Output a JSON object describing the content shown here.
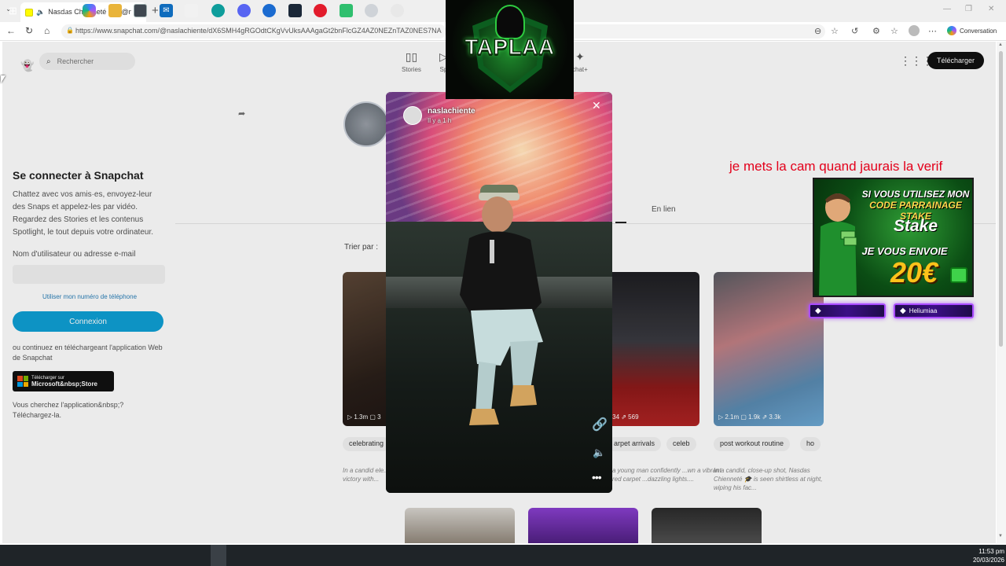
{
  "browser": {
    "tab_title": "Nasdas Chienneté 🎓 (@nasl",
    "tab_close": "✕",
    "new_tab": "+",
    "url": "https://www.snapchat.com/@naslachiente/dX6SMH4gRGOdtCKgVvUksAAAgaGt2bnFlcGZ4AZ0NEZnTAZ0NES7NA",
    "copilot_label": "Conversation",
    "window_controls": [
      "—",
      "❐",
      "✕"
    ]
  },
  "header": {
    "search_placeholder": "Rechercher",
    "nav": [
      {
        "label": "Stories",
        "icon": "stories-icon"
      },
      {
        "label": "Sp",
        "icon": "spotlight-icon"
      },
      {
        "label": "chat+",
        "icon": "snapchat-plus-icon"
      }
    ],
    "download_label": "Télécharger"
  },
  "login": {
    "title": "Se connecter à Snapchat",
    "description": "Chattez avec vos amis·es, envoyez-leur des Snaps et appelez-les par vidéo. Regardez des Stories et les contenus Spotlight, le tout depuis votre ordinateur.",
    "field_label": "Nom d'utilisateur ou adresse e-mail",
    "phone_link": "Utiliser mon numéro de téléphone",
    "login_button": "Connexion",
    "alt_text": "ou continuez en téléchargeant l'application Web de Snapchat",
    "store_small": "Télécharger sur",
    "store_name": "Microsoft&nbsp;Store",
    "looking_text": "Vous cherchez l'application&nbsp;? Téléchargez-la."
  },
  "profile": {
    "tab_label": "En lien",
    "sort_label": "Trier par :"
  },
  "cards": [
    {
      "stats": "▷ 1.3m  ▢ 3",
      "chip": "celebrating",
      "caption": "In a candid ele... Nasdas Chien... a victory with..."
    },
    {
      "stats": "m  ▢ 634  ⇗ 569",
      "chip": "arpet arrivals",
      "chip2": "celeb",
      "caption": "a young man confidently ...wn a vibrant red carpet ...dazzling lights...."
    },
    {
      "stats": "▷ 2.1m  ▢ 1.9k  ⇗ 3.3k",
      "chip": "post workout routine",
      "chip2": "ho",
      "caption": "In a candid, close-up shot, Nasdas Chienneté 🎓 is seen shirtless at night, wiping his fac..."
    }
  ],
  "story": {
    "username": "naslachiente",
    "time": "Il y a 1 h",
    "close": "✕",
    "link_icon": "link-icon",
    "sound_icon": "speaker-icon",
    "more": "•••"
  },
  "stream": {
    "logo_text": "TAPLAA",
    "cam_message": "je mets la cam quand jaurais la verif",
    "stake": {
      "line1": "SI VOUS UTILISEZ MON",
      "line2": "CODE PARRAINAGE STAKE",
      "brand": "Stake",
      "line3": "JE VOUS ENVOIE",
      "amount": "20€"
    },
    "sub_left": "",
    "sub_right": "Heliumiaa"
  },
  "taskbar": {
    "time": "11:53 pm",
    "date": "20/03/2026"
  },
  "colors": {
    "login_button": "#0fa0d5",
    "download_button": "#111111",
    "cam_message": "#e3001b",
    "stake_amount": "#ffc21a",
    "sub_border": "#a94bff"
  }
}
